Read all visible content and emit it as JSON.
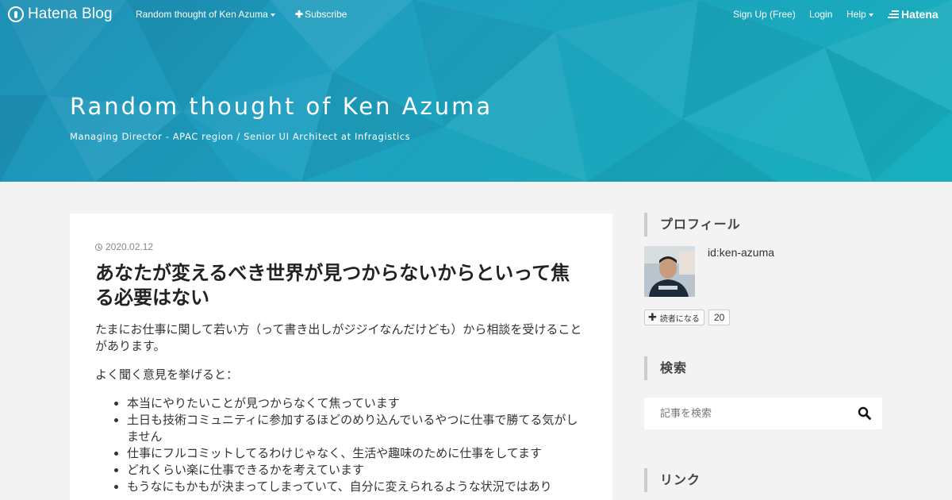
{
  "header": {
    "logo_text": "Hatena Blog",
    "blog_menu_label": "Random thought of Ken Azuma",
    "subscribe_label": "Subscribe",
    "signup_label": "Sign Up (Free)",
    "login_label": "Login",
    "help_label": "Help",
    "hatena_label": "Hatena",
    "icons": [
      "hatena-blog-logo-icon",
      "caret-down-icon",
      "plus-icon",
      "hatena-logo-icon"
    ]
  },
  "blog": {
    "title": "Random thought of Ken Azuma",
    "description": "Managing Director - APAC region / Senior UI Architect at Infragistics"
  },
  "article": {
    "date": "2020.02.12",
    "title": "あなたが変えるべき世界が見つからないからといって焦る必要はない",
    "paragraphs": [
      "たまにお仕事に関して若い方（って書き出しがジジイなんだけども）から相談を受けることがあります。",
      "よく聞く意見を挙げると："
    ],
    "list_items": [
      "本当にやりたいことが見つからなくて焦っています",
      "土日も技術コミュニティに参加するほどのめり込んでいるやつに仕事で勝てる気がしません",
      "仕事にフルコミットしてるわけじゃなく、生活や趣味のために仕事をしてます",
      "どれくらい楽に仕事できるかを考えています",
      "もうなにもかもが決まってしまっていて、自分に変えられるような状況ではあり"
    ]
  },
  "sidebar": {
    "profile": {
      "heading": "プロフィール",
      "user_id": "id:ken-azuma",
      "subscribe_label": "読者になる",
      "subscriber_count": "20"
    },
    "search": {
      "heading": "検索",
      "placeholder": "記事を検索"
    },
    "links": {
      "heading": "リンク"
    }
  },
  "colors": {
    "hero_gradient_start": "#1d8fb5",
    "hero_gradient_end": "#18b0bf",
    "page_background": "#f3f3f3",
    "card_background": "#ffffff",
    "sidebar_heading_border": "#cccccc"
  }
}
